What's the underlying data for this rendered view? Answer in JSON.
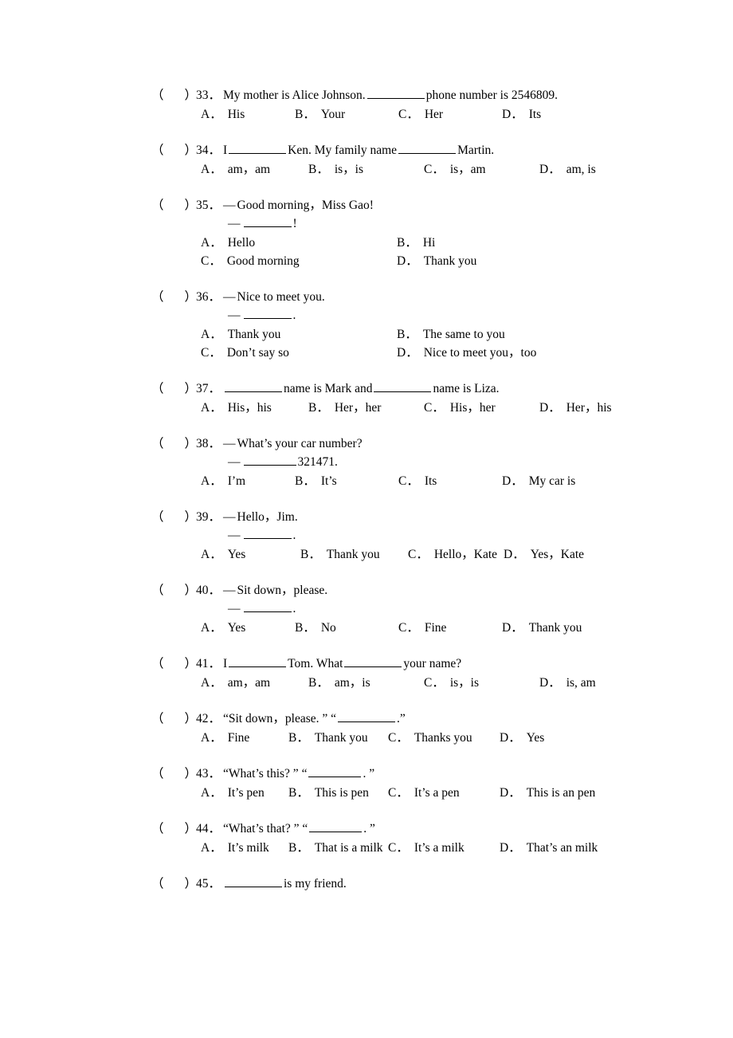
{
  "page": {
    "bracket_open": "（",
    "bracket_close": "）",
    "dash": "—"
  },
  "questions": [
    {
      "number": "33．",
      "stem_before": "My mother is Alice Johnson.",
      "stem_after": "phone number is 2546809.",
      "layout": "four-across",
      "options": [
        {
          "label": "A．",
          "text": "His"
        },
        {
          "label": "B．",
          "text": "Your"
        },
        {
          "label": "C．",
          "text": "Her"
        },
        {
          "label": "D．",
          "text": "Its"
        }
      ]
    },
    {
      "number": "34．",
      "stem_before": "I",
      "stem_mid": "Ken. My family name",
      "stem_after": "Martin.",
      "layout": "four-across",
      "options": [
        {
          "label": "A．",
          "text": "am，am"
        },
        {
          "label": "B．",
          "text": "is，is"
        },
        {
          "label": "C．",
          "text": "is，am"
        },
        {
          "label": "D．",
          "text": "am, is"
        }
      ]
    },
    {
      "number": "35．",
      "dialog_line1": "Good morning，Miss Gao!",
      "dialog_line2_after": "!",
      "layout": "two-column",
      "options": [
        {
          "label": "A．",
          "text": "Hello"
        },
        {
          "label": "B．",
          "text": "Hi"
        },
        {
          "label": "C．",
          "text": "Good morning"
        },
        {
          "label": "D．",
          "text": "Thank you"
        }
      ]
    },
    {
      "number": "36．",
      "dialog_line1": "Nice to meet you.",
      "dialog_line2_after": ".",
      "layout": "two-column",
      "options": [
        {
          "label": "A．",
          "text": "Thank you"
        },
        {
          "label": "B．",
          "text": "The same to you"
        },
        {
          "label": "C．",
          "text": "Don’t say so"
        },
        {
          "label": "D．",
          "text": "Nice to meet you，too"
        }
      ]
    },
    {
      "number": "37．",
      "stem_mid": "name is Mark and",
      "stem_after": "name is Liza.",
      "layout": "four-across",
      "options": [
        {
          "label": "A．",
          "text": "His，his"
        },
        {
          "label": "B．",
          "text": "Her，her"
        },
        {
          "label": "C．",
          "text": "His，her"
        },
        {
          "label": "D．",
          "text": "Her，his"
        }
      ]
    },
    {
      "number": "38．",
      "dialog_line1": "What’s your car number?",
      "dialog_line2_after": "321471.",
      "layout": "four-across",
      "options": [
        {
          "label": "A．",
          "text": "I’m"
        },
        {
          "label": "B．",
          "text": "It’s"
        },
        {
          "label": "C．",
          "text": "Its"
        },
        {
          "label": "D．",
          "text": "My car is"
        }
      ]
    },
    {
      "number": "39．",
      "dialog_line1": "Hello，Jim.",
      "dialog_line2_after": ".",
      "layout": "four-across",
      "options": [
        {
          "label": "A．",
          "text": "Yes"
        },
        {
          "label": "B．",
          "text": "Thank you"
        },
        {
          "label": "C．",
          "text": "Hello，Kate"
        },
        {
          "label": "D．",
          "text": "Yes，Kate"
        }
      ]
    },
    {
      "number": "40．",
      "dialog_line1": "Sit down，please.",
      "dialog_line2_after": ".",
      "layout": "four-across",
      "options": [
        {
          "label": "A．",
          "text": "Yes"
        },
        {
          "label": "B．",
          "text": "No"
        },
        {
          "label": "C．",
          "text": "Fine"
        },
        {
          "label": "D．",
          "text": "Thank you"
        }
      ]
    },
    {
      "number": "41．",
      "stem_before": "I",
      "stem_mid": "Tom. What",
      "stem_after": "your name?",
      "layout": "four-across",
      "options": [
        {
          "label": "A．",
          "text": "am，am"
        },
        {
          "label": "B．",
          "text": "am，is"
        },
        {
          "label": "C．",
          "text": "is，is"
        },
        {
          "label": "D．",
          "text": "is, am"
        }
      ]
    },
    {
      "number": "42．",
      "stem_before": "“Sit down，please. ” “",
      "stem_after": ".”",
      "layout": "four-across",
      "options": [
        {
          "label": "A．",
          "text": "Fine"
        },
        {
          "label": "B．",
          "text": "Thank you"
        },
        {
          "label": "C．",
          "text": "Thanks you"
        },
        {
          "label": "D．",
          "text": "Yes"
        }
      ]
    },
    {
      "number": "43．",
      "stem_before": "“What’s this? ” “",
      "stem_after": ". ”",
      "layout": "four-across",
      "options": [
        {
          "label": "A．",
          "text": "It’s pen"
        },
        {
          "label": "B．",
          "text": "This is pen"
        },
        {
          "label": "C．",
          "text": "It’s a pen"
        },
        {
          "label": "D．",
          "text": "This is an pen"
        }
      ]
    },
    {
      "number": "44．",
      "stem_before": "“What’s that? ” “",
      "stem_after": ". ”",
      "layout": "four-across",
      "options": [
        {
          "label": "A．",
          "text": "It’s milk"
        },
        {
          "label": "B．",
          "text": "That is a milk"
        },
        {
          "label": "C．",
          "text": "It’s a milk"
        },
        {
          "label": "D．",
          "text": "That’s an milk"
        }
      ]
    },
    {
      "number": "45．",
      "stem_after": "is my friend.",
      "layout": "none",
      "options": []
    }
  ]
}
